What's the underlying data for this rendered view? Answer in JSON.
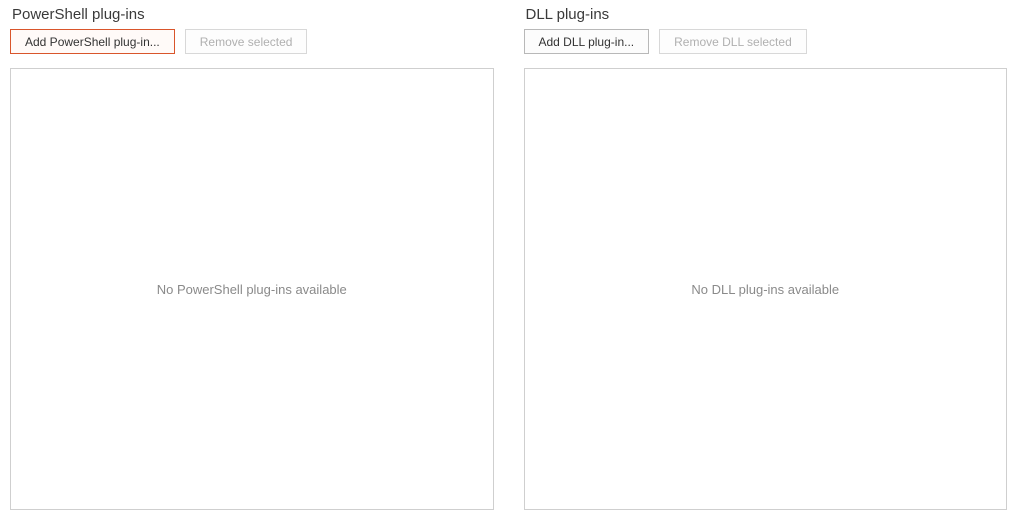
{
  "powershell": {
    "title": "PowerShell plug-ins",
    "buttons": {
      "add": "Add PowerShell plug-in...",
      "remove": "Remove selected"
    },
    "empty_text": "No PowerShell plug-ins available"
  },
  "dll": {
    "title": "DLL plug-ins",
    "buttons": {
      "add": "Add DLL plug-in...",
      "remove": "Remove DLL selected"
    },
    "empty_text": "No DLL plug-ins available"
  }
}
